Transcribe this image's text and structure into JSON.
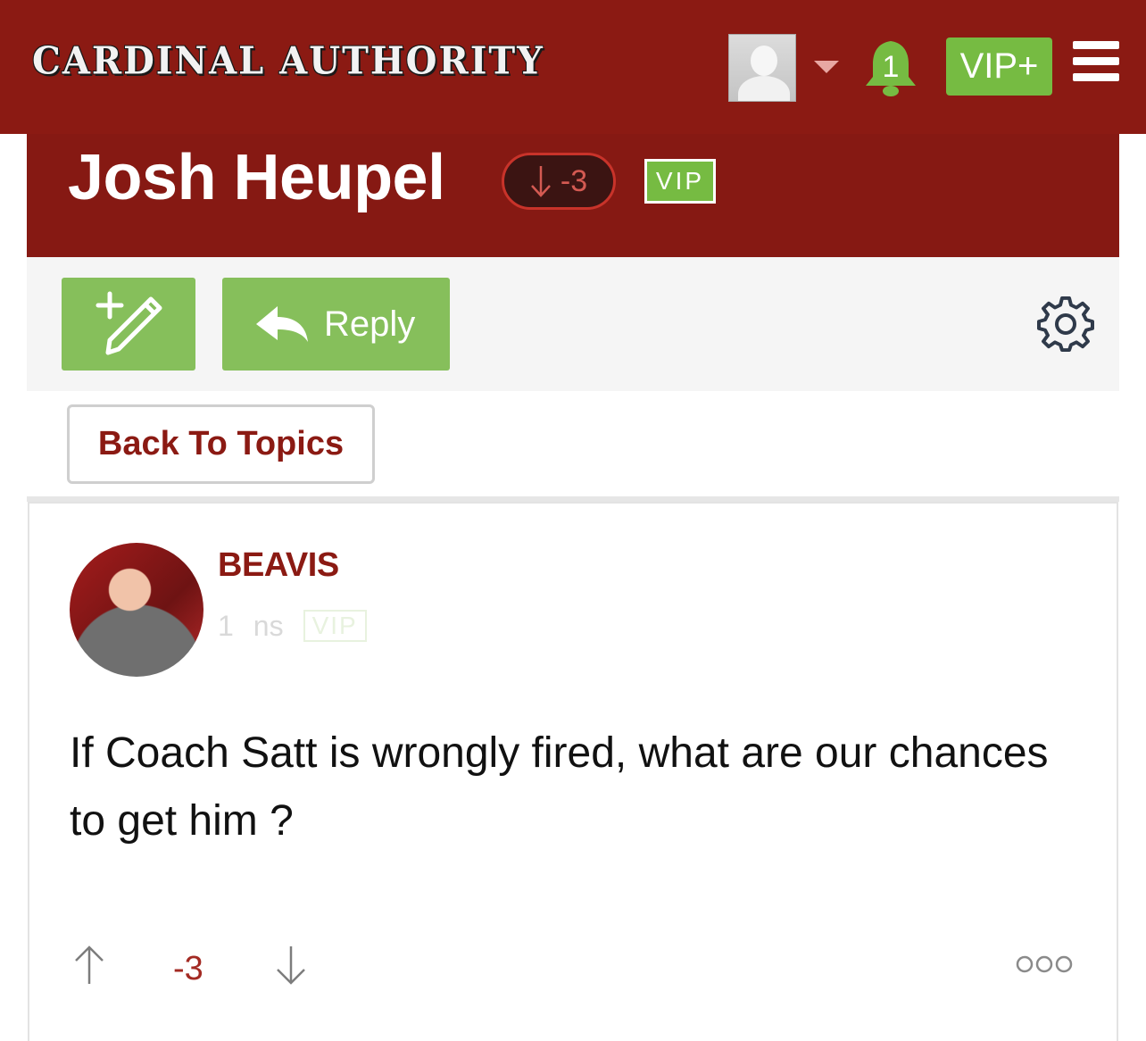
{
  "header": {
    "logo_text": "CARDINAL AUTHORITY",
    "notification_count": "1",
    "vip_plus_label": "VIP+"
  },
  "topic": {
    "title": "Josh Heupel",
    "score": "-3",
    "vip_label": "VIP"
  },
  "actions": {
    "reply_label": "Reply",
    "back_label": "Back To Topics"
  },
  "post": {
    "author": "BEAVIS",
    "meta_time": "1",
    "meta_unit": "ns",
    "meta_vip": "VIP",
    "body": "If Coach Satt is wrongly fired, what are our chances to get him ?",
    "votes": "-3"
  },
  "colors": {
    "brand_red": "#8b1a13",
    "accent_green": "#76bb42",
    "button_green": "#86bf5b"
  },
  "icons": [
    "user-avatar-placeholder",
    "caret-down-icon",
    "bell-icon",
    "hamburger-icon",
    "new-topic-icon",
    "reply-arrow-icon",
    "gear-icon",
    "arrow-up-icon",
    "arrow-down-icon",
    "more-icon"
  ]
}
